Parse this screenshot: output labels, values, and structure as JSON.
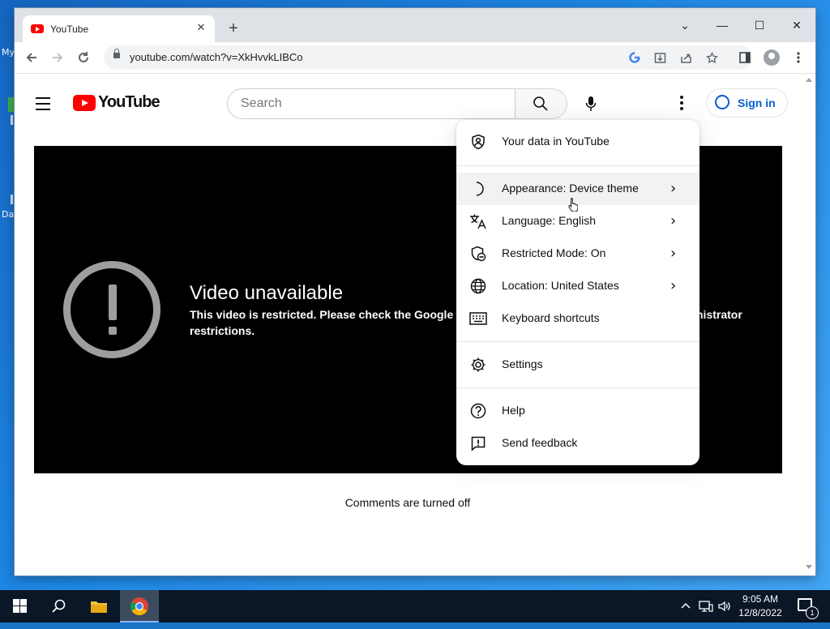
{
  "desktop": {
    "icon_labels": [
      "My",
      "Da"
    ]
  },
  "browser": {
    "tab": {
      "title": "YouTube",
      "close": "✕"
    },
    "new_tab": "+",
    "window_controls": {
      "minimize": "—",
      "restore": "☐",
      "close": "✕",
      "tab_list": "⌄"
    },
    "url": "youtube.com/watch?v=XkHvvkLIBCo"
  },
  "youtube": {
    "logo_text": "YouTube",
    "search_placeholder": "Search",
    "sign_in": "Sign in",
    "video_unavailable": {
      "title": "Video unavailable",
      "message": "This video is restricted. Please check the Google Workspace administrator restrictions.",
      "message_left": "This video is restricted. Please check the Google We",
      "message_right": "nistrator",
      "message_line2": "restrictions."
    },
    "comments_status": "Comments are turned off"
  },
  "menu": {
    "items": [
      {
        "label": "Your data in YouTube",
        "icon": "shield-person-icon"
      },
      {
        "label": "Appearance: Device theme",
        "icon": "moon-icon",
        "has_submenu": true,
        "hovered": true
      },
      {
        "label": "Language: English",
        "icon": "translate-icon",
        "has_submenu": true
      },
      {
        "label": "Restricted Mode: On",
        "icon": "restricted-shield-icon",
        "has_submenu": true
      },
      {
        "label": "Location: United States",
        "icon": "globe-icon",
        "has_submenu": true
      },
      {
        "label": "Keyboard shortcuts",
        "icon": "keyboard-icon"
      },
      {
        "label": "Settings",
        "icon": "gear-icon"
      },
      {
        "label": "Help",
        "icon": "help-circle-icon"
      },
      {
        "label": "Send feedback",
        "icon": "feedback-icon"
      }
    ]
  },
  "taskbar": {
    "time": "9:05 AM",
    "date": "12/8/2022",
    "notification_count": "1"
  }
}
